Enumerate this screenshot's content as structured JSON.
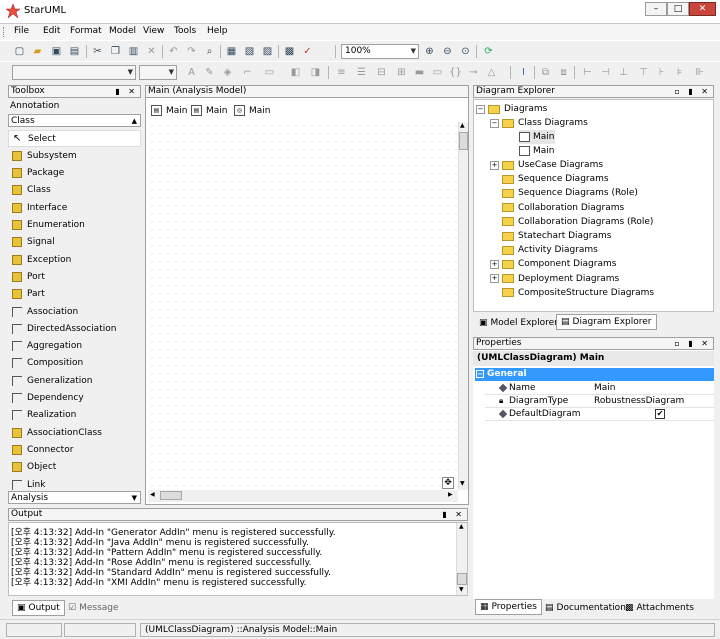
{
  "app": {
    "title": "StarUML",
    "window_controls": {
      "minimize": "–",
      "maximize": "□",
      "close": "✕"
    }
  },
  "menu": {
    "items": [
      "File",
      "Edit",
      "Format",
      "Model",
      "View",
      "Tools",
      "Help"
    ]
  },
  "toolbar": {
    "zoom_value": "100%"
  },
  "toolbox": {
    "title": "Toolbox",
    "categories": {
      "top1": "Annotation",
      "top2": "Class",
      "bottom": "Analysis"
    },
    "items": [
      "Select",
      "Subsystem",
      "Package",
      "Class",
      "Interface",
      "Enumeration",
      "Signal",
      "Exception",
      "Port",
      "Part",
      "Association",
      "DirectedAssociation",
      "Aggregation",
      "Composition",
      "Generalization",
      "Dependency",
      "Realization",
      "AssociationClass",
      "Connector",
      "Object",
      "Link"
    ]
  },
  "diagram_pane": {
    "title": "Main (Analysis Model)",
    "tabs": [
      "Main",
      "Main",
      "Main"
    ]
  },
  "diagram_explorer": {
    "title": "Diagram Explorer",
    "root": "Diagrams",
    "class_diagrams": "Class Diagrams",
    "class_children": [
      "Main",
      "Main"
    ],
    "other_folders": [
      "UseCase Diagrams",
      "Sequence Diagrams",
      "Sequence Diagrams (Role)",
      "Collaboration Diagrams",
      "Collaboration Diagrams (Role)",
      "Statechart Diagrams",
      "Activity Diagrams",
      "Component Diagrams",
      "Deployment Diagrams",
      "CompositeStructure Diagrams"
    ],
    "tabs": [
      "Model Explorer",
      "Diagram Explorer"
    ]
  },
  "properties": {
    "title": "Properties",
    "subject": "(UMLClassDiagram) Main",
    "section": "General",
    "rows": [
      {
        "key": "Name",
        "value": "Main"
      },
      {
        "key": "DiagramType",
        "value": "RobustnessDiagram"
      },
      {
        "key": "DefaultDiagram",
        "value": "✔"
      }
    ],
    "tabs": [
      "Properties",
      "Documentation",
      "Attachments"
    ]
  },
  "output": {
    "title": "Output",
    "lines": [
      "[오후 4:13:32]  Add-In \"Generator AddIn\" menu is registered successfully.",
      "[오후 4:13:32]  Add-In \"Java AddIn\" menu is registered successfully.",
      "[오후 4:13:32]  Add-In \"Pattern AddIn\" menu is registered successfully.",
      "[오후 4:13:32]  Add-In \"Rose AddIn\" menu is registered successfully.",
      "[오후 4:13:32]  Add-In \"Standard AddIn\" menu is registered successfully.",
      "[오후 4:13:32]  Add-In \"XMI AddIn\" menu is registered successfully."
    ],
    "tabs": [
      "Output",
      "Message"
    ]
  },
  "status": {
    "path": "(UMLClassDiagram) ::Analysis Model::Main"
  },
  "colors": {
    "selection": "#3399ff",
    "folder": "#f5d24a",
    "close_button": "#c8463c"
  }
}
